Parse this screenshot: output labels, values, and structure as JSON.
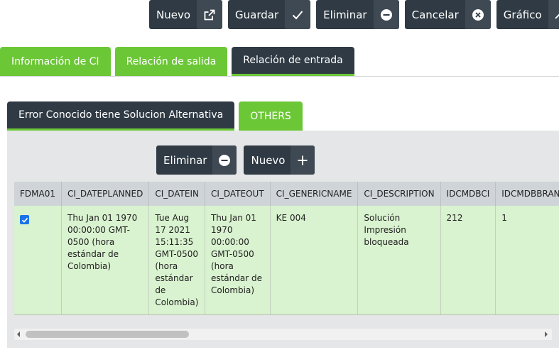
{
  "toolbar": {
    "buttons": [
      {
        "label": "Nuevo",
        "icon": "external-link-icon"
      },
      {
        "label": "Guardar",
        "icon": "check-icon"
      },
      {
        "label": "Eliminar",
        "icon": "minus-circle-icon"
      },
      {
        "label": "Cancelar",
        "icon": "x-circle-icon"
      },
      {
        "label": "Gráfico",
        "icon": "trending-up-icon"
      }
    ]
  },
  "tabs": [
    {
      "label": "Información de CI",
      "active": false
    },
    {
      "label": "Relación de salida",
      "active": false
    },
    {
      "label": "Relación de entrada",
      "active": true
    }
  ],
  "subtabs": [
    {
      "label": "Error Conocido tiene Solucion Alternativa",
      "active": true
    },
    {
      "label": "OTHERS",
      "active": false
    }
  ],
  "panel": {
    "eliminar_label": "Eliminar",
    "nuevo_label": "Nuevo"
  },
  "table": {
    "columns": [
      "FDMA01",
      "CI_DATEPLANNED",
      "CI_DATEIN",
      "CI_DATEOUT",
      "CI_GENERICNAME",
      "CI_DESCRIPTION",
      "IDCMDBCI",
      "IDCMDBBRAND"
    ],
    "rows": [
      {
        "checked": true,
        "ci_dateplanned": "Thu Jan 01 1970 00:00:00 GMT-0500 (hora estándar de Colombia)",
        "ci_datein": "Tue Aug 17 2021 15:11:35 GMT-0500 (hora estándar de Colombia)",
        "ci_dateout": "Thu Jan 01 1970 00:00:00 GMT-0500 (hora estándar de Colombia)",
        "ci_genericname": "KE 004",
        "ci_description": "Solución Impresión bloqueada",
        "idcmdbci": "212",
        "idcmdbbrand": "1"
      }
    ]
  },
  "colors": {
    "dark": "#2f3a44",
    "green": "#6cc737",
    "row_bg": "#d9f2cf",
    "header_bg": "#cfd4d8"
  }
}
